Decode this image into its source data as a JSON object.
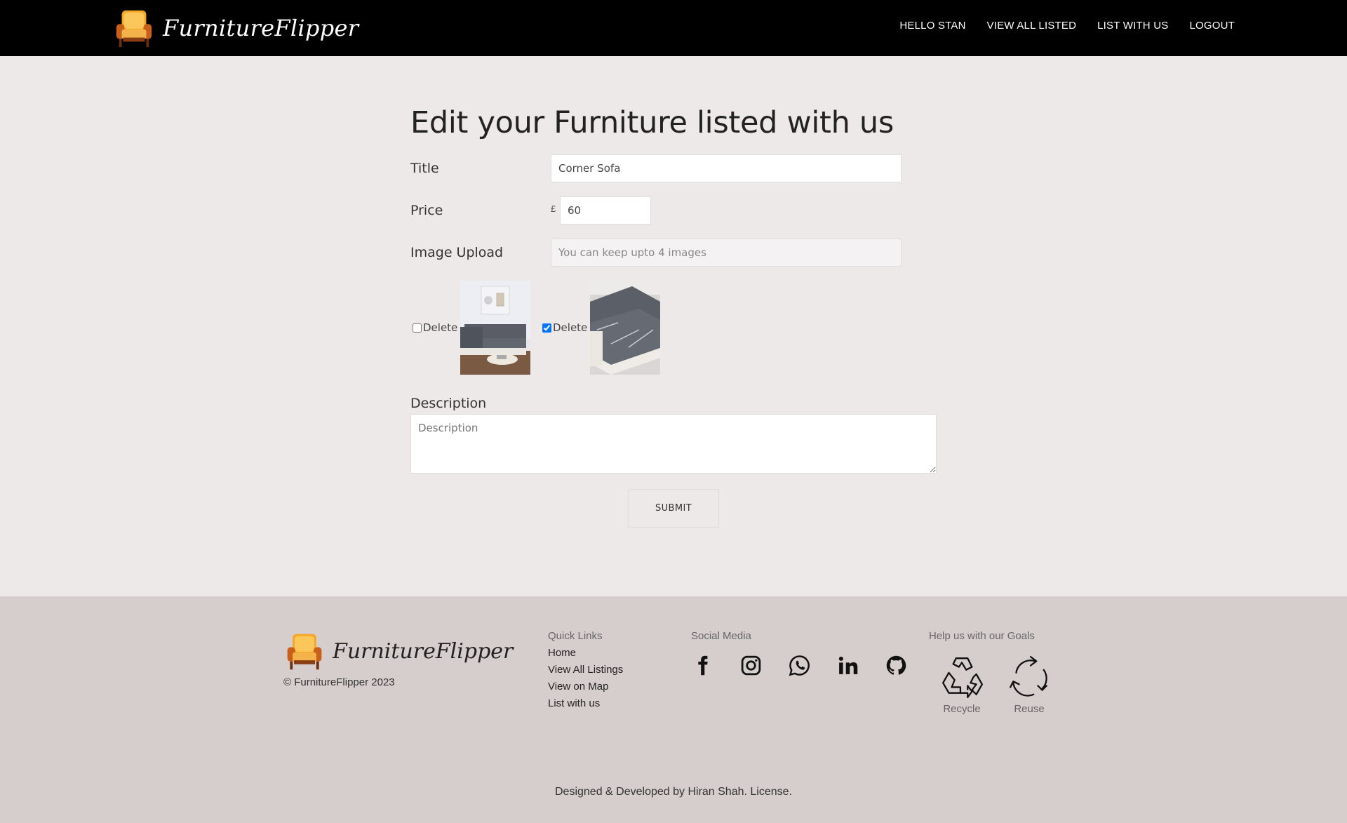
{
  "navbar": {
    "brand": "FurnitureFlipper",
    "links": [
      "HELLO STAN",
      "VIEW ALL LISTED",
      "LIST WITH US",
      "LOGOUT"
    ]
  },
  "form": {
    "title": "Edit your Furniture listed with us",
    "title_label": "Title",
    "title_value": "Corner Sofa",
    "price_label": "Price",
    "currency_symbol": "£",
    "price_value": "60",
    "image_label": "Image Upload",
    "image_placeholder": "You can keep upto 4 images",
    "images": [
      {
        "delete_label": "Delete",
        "checked": false
      },
      {
        "delete_label": "Delete",
        "checked": true
      }
    ],
    "description_label": "Description",
    "description_placeholder": "Description",
    "submit_label": "SUBMIT"
  },
  "footer": {
    "brand": "FurnitureFlipper",
    "copyright": "© FurnitureFlipper 2023",
    "quick_links_title": "Quick Links",
    "quick_links": [
      "Home",
      "View All Listings",
      "View on Map",
      "List with us"
    ],
    "social_title": "Social Media",
    "social_icons": [
      "facebook-icon",
      "instagram-icon",
      "whatsapp-icon",
      "linkedin-icon",
      "github-icon"
    ],
    "goals_title": "Help us with our Goals",
    "goals": [
      "Recycle",
      "Reuse"
    ],
    "designed_prefix": "Designed & Developed by ",
    "designed_author": "Hiran Shah",
    "license_label": "License."
  },
  "colors": {
    "navbar_bg": "#000000",
    "page_bg": "#ede9e8",
    "footer_bg": "#d6cdcd"
  }
}
